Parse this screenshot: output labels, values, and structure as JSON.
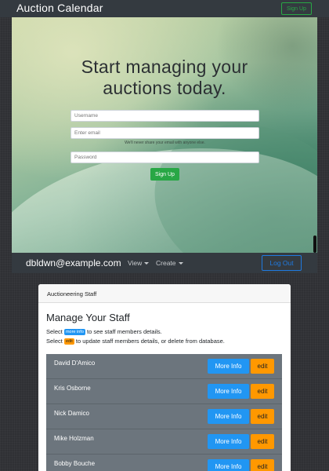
{
  "topbar": {
    "brand": "Auction Calendar",
    "signup_label": "Sign Up"
  },
  "hero": {
    "title_line1": "Start managing your",
    "title_line2": "auctions today.",
    "username_placeholder": "Username",
    "email_placeholder": "Enter email",
    "email_hint": "We'll never share your email with anyone else.",
    "password_placeholder": "Password",
    "signup_label": "Sign Up"
  },
  "subbar": {
    "user_email": "dbldwn@example.com",
    "view_label": "View",
    "create_label": "Create",
    "logout_label": "Log Out"
  },
  "staff_card": {
    "header": "Auctioneering Staff",
    "title": "Manage Your Staff",
    "instr1_prefix": "Select",
    "instr1_chip": "more info",
    "instr1_suffix": "to see staff members details.",
    "instr2_prefix": "Select",
    "instr2_chip": "edit",
    "instr2_suffix": "to update staff members details, or delete from database.",
    "more_label": "More Info",
    "edit_label": "edit",
    "staff": [
      {
        "name": "David D'Amico"
      },
      {
        "name": "Kris Osborne"
      },
      {
        "name": "Nick Damico"
      },
      {
        "name": "Mike Holzman"
      },
      {
        "name": "Bobby Bouche"
      }
    ]
  },
  "colors": {
    "navbar": "#343a40",
    "success": "#28a745",
    "primary": "#1f7ae0",
    "info": "#2196f3",
    "warning": "#ff9800",
    "row": "#6c757d"
  }
}
